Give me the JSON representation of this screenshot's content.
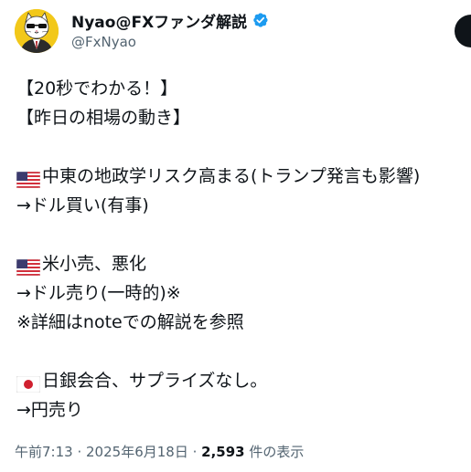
{
  "author": {
    "display_name": "Nyao@FXファンダ解説",
    "handle": "@FxNyao",
    "avatar_icon": "cat-in-suit-avatar",
    "verified_icon": "verified-badge-icon",
    "verified_color": "#1d9bf0"
  },
  "post": {
    "lines": [
      "【20秒でわかる！】",
      "【昨日の相場の動き】",
      "",
      "中東の地政学リスク高まる(トランプ発言も影響)",
      "→ドル買い(有事)",
      "",
      "米小売、悪化",
      "→ドル売り(一時的)※",
      "※詳細はnoteでの解説を参照",
      "",
      " 日銀会合、サプライズなし。",
      "→円売り"
    ],
    "flags": {
      "line_3": "us-flag-icon",
      "line_6": "us-flag-icon",
      "line_10": "japan-flag-icon"
    }
  },
  "meta": {
    "time": "午前7:13",
    "separator": "·",
    "date": "2025年6月18日",
    "views_count": "2,593",
    "views_label": "件の表示"
  },
  "colors": {
    "text": "#0f1419",
    "secondary": "#536471",
    "avatar_bg": "#f2c81a"
  }
}
